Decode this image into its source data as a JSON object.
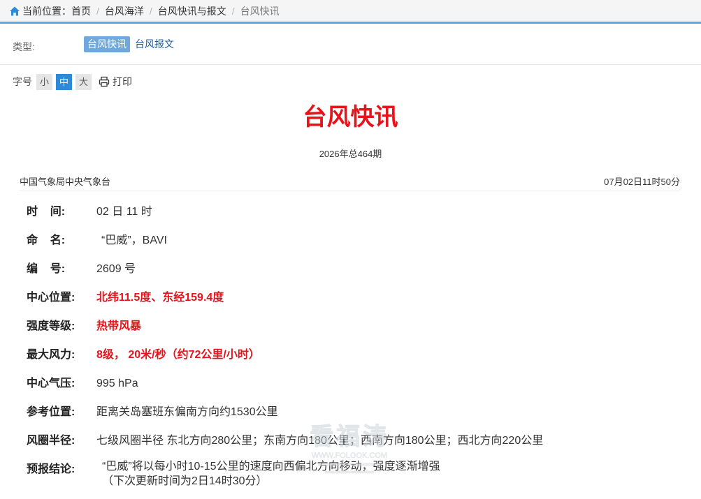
{
  "breadcrumb": {
    "label": "当前位置：",
    "items": [
      "首页",
      "台风海洋",
      "台风快讯与报文"
    ],
    "current": "台风快讯"
  },
  "type_filter": {
    "label": "类型:",
    "options": [
      "台风快讯",
      "台风报文"
    ],
    "selected": "台风快讯"
  },
  "font_size": {
    "label": "字号",
    "options": [
      "小",
      "中",
      "大"
    ],
    "selected": "中",
    "print_label": "打印"
  },
  "article": {
    "title": "台风快讯",
    "issue": "2026年总464期",
    "source": "中国气象局中央气象台",
    "time": "07月02日11时50分"
  },
  "details": [
    {
      "label": "时    间:",
      "value": "02 日 11 时"
    },
    {
      "label": "命    名:",
      "value": "“巴威”，BAVI"
    },
    {
      "label": "编    号:",
      "value": "2609 号"
    },
    {
      "label": "中心位置:",
      "value": "北纬11.5度、东经159.4度"
    },
    {
      "label": "强度等级:",
      "value": "热带风暴"
    },
    {
      "label": "最大风力:",
      "value": "8级， 20米/秒（约72公里/小时）"
    },
    {
      "label": "中心气压:",
      "value": "995 hPa"
    },
    {
      "label": "参考位置:",
      "value": "距离关岛塞班东偏南方向约1530公里"
    },
    {
      "label": "风圈半径:",
      "value": "七级风圈半径 东北方向280公里；东南方向180公里；西南方向180公里；西北方向220公里"
    }
  ],
  "conclusion": {
    "label": "预报结论:",
    "line1": "“巴威”将以每小时10-15公里的速度向西偏北方向移动，强度逐渐增强",
    "line2": "（下次更新时间为2日14时30分）"
  },
  "watermark": {
    "title": "看福涛",
    "url": "WWW.FOLOOK.COM"
  },
  "colors": {
    "accent_blue": "#5aa7e6",
    "tag_active_bg": "#6fa8dc",
    "highlight_red": "#e8131a",
    "font_btn_active": "#2d8ad8"
  }
}
